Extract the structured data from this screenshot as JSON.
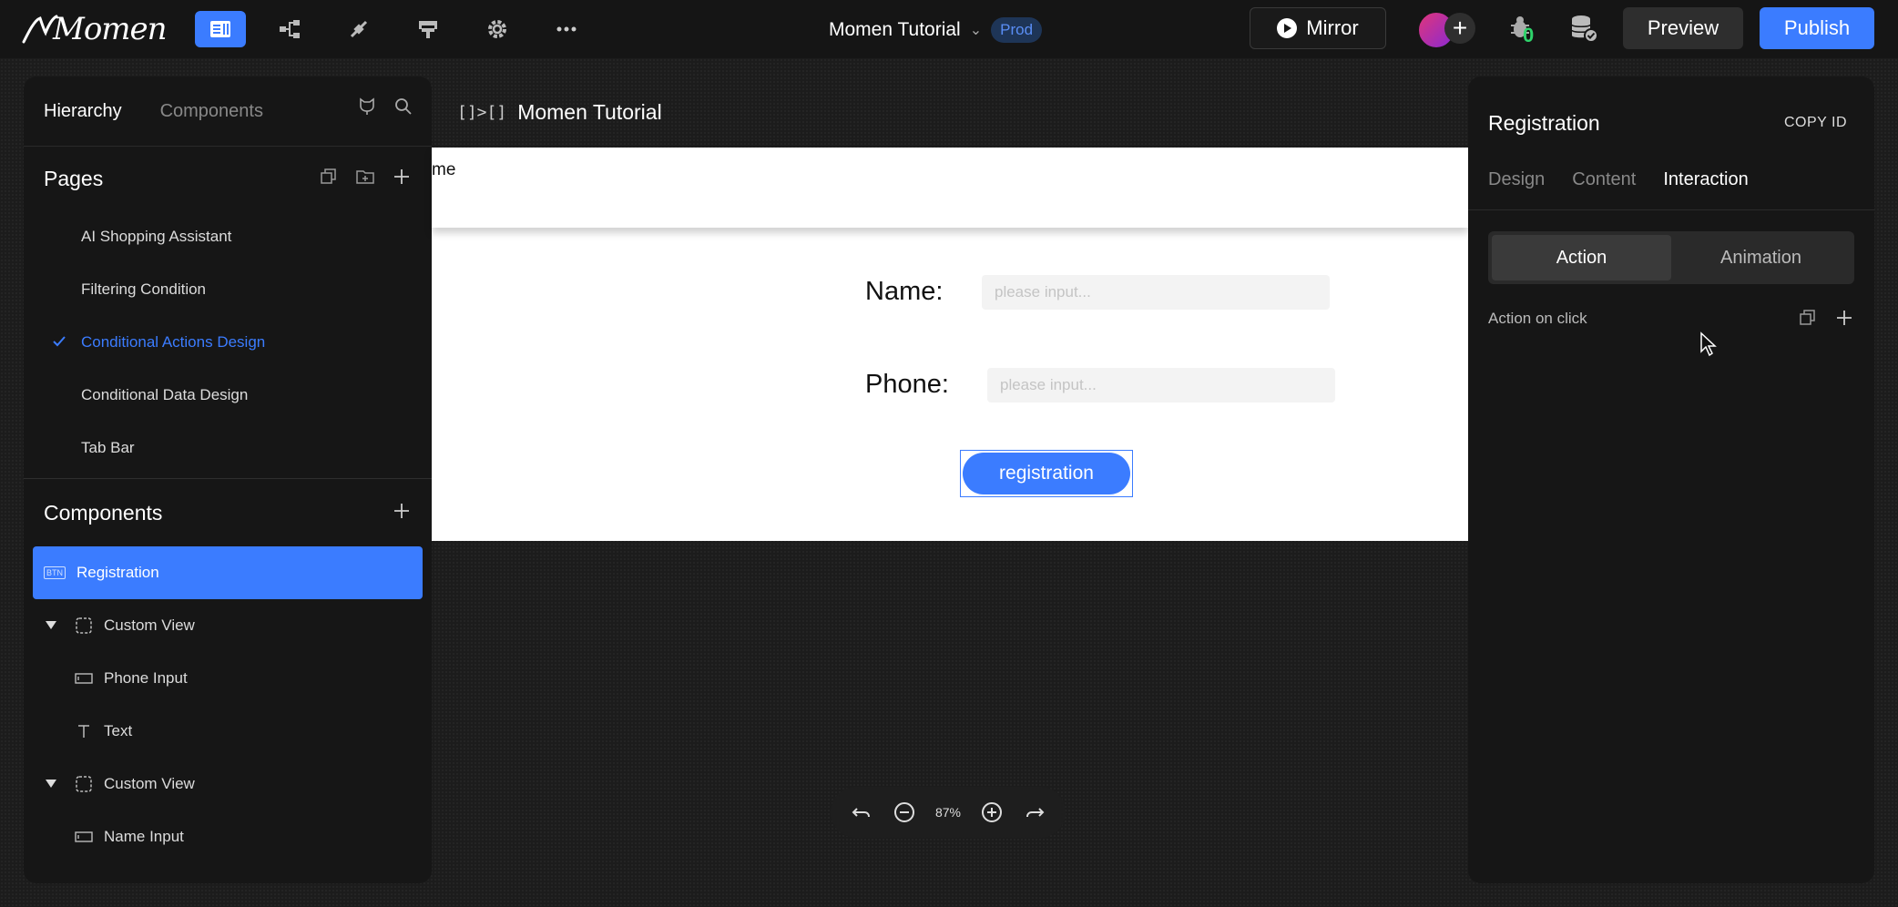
{
  "topbar": {
    "logo": "Momen",
    "project_title": "Momen Tutorial",
    "env_badge": "Prod",
    "mirror_label": "Mirror",
    "bug_count": "0",
    "preview_label": "Preview",
    "publish_label": "Publish",
    "nav_icons": [
      "pages-icon",
      "data-model-icon",
      "actions-icon",
      "api-icon",
      "settings-icon",
      "more-icon"
    ]
  },
  "left_panel": {
    "tabs": [
      "Hierarchy",
      "Components"
    ],
    "pages_title": "Pages",
    "pages": [
      {
        "label": "AI Shopping Assistant",
        "selected": false
      },
      {
        "label": "Filtering Condition",
        "selected": false
      },
      {
        "label": "Conditional Actions Design",
        "selected": true
      },
      {
        "label": "Conditional Data Design",
        "selected": false
      },
      {
        "label": "Tab Bar",
        "selected": false
      }
    ],
    "components_title": "Components",
    "selected_component": "Registration",
    "selected_component_tag": "BTN",
    "tree": [
      {
        "label": "Custom View",
        "type": "view",
        "expanded": true
      },
      {
        "label": "Phone Input",
        "type": "input"
      },
      {
        "label": "Text",
        "type": "text"
      },
      {
        "label": "Custom View",
        "type": "view",
        "expanded": true
      },
      {
        "label": "Name Input",
        "type": "input"
      }
    ]
  },
  "canvas": {
    "title": "Momen Tutorial",
    "header_text": "me",
    "name_label": "Name:",
    "name_placeholder": "please input...",
    "phone_label": "Phone:",
    "phone_placeholder": "please input...",
    "button_label": "registration",
    "zoom": "87%"
  },
  "right_panel": {
    "title": "Registration",
    "copy_id": "COPY ID",
    "tabs": [
      "Design",
      "Content",
      "Interaction"
    ],
    "active_tab": "Interaction",
    "segments": [
      "Action",
      "Animation"
    ],
    "action_on_click": "Action on click"
  },
  "colors": {
    "accent": "#3b7cff",
    "panel": "#161616",
    "background": "#1c1c1c",
    "success": "#2ed46b"
  }
}
